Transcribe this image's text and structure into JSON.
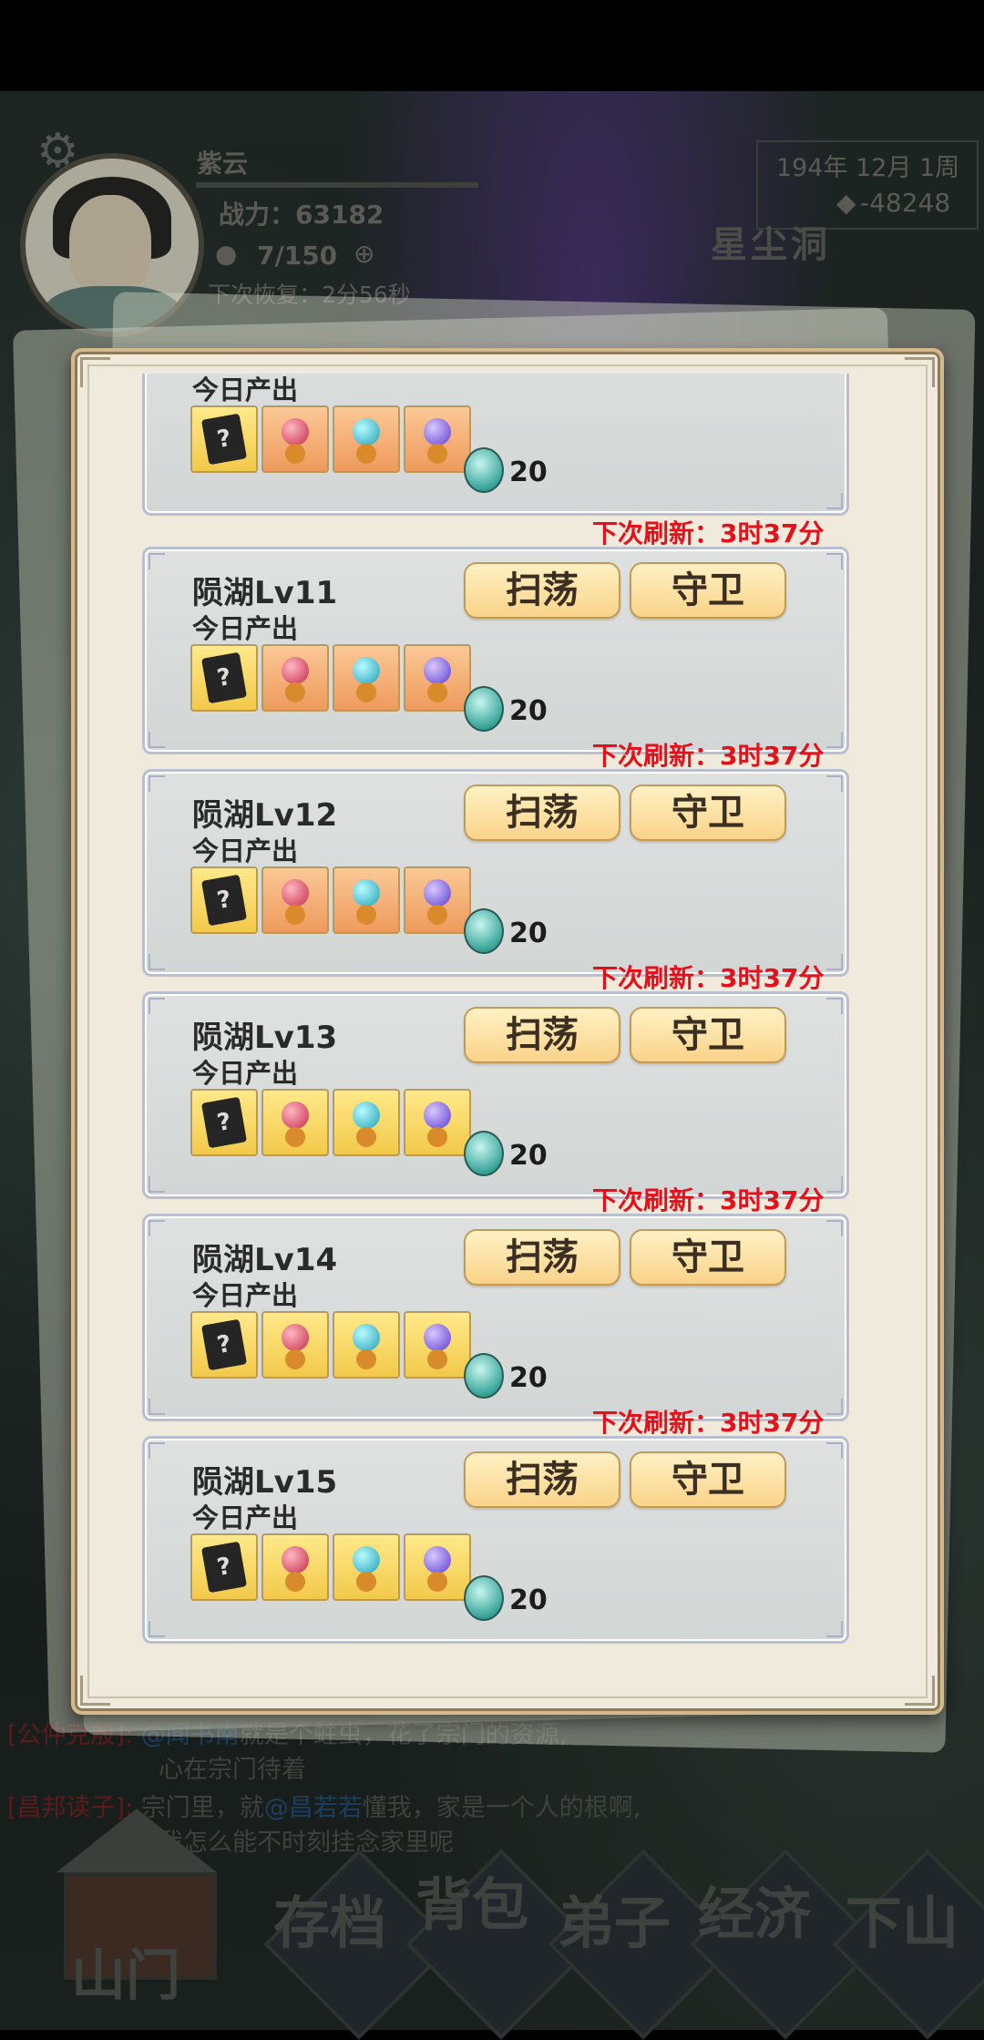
{
  "header": {
    "player_name": "紫云",
    "power": "战力：63182",
    "stamina": "7/150",
    "recover": "下次恢复：2分56秒",
    "date": "194年 12月  1周",
    "currency": "-48248",
    "location": "星尘洞"
  },
  "panel": {
    "partial_card": {
      "today_label": "今日产出",
      "count": "20",
      "refresh": "下次刷新：3时37分"
    },
    "sweep_label": "扫荡",
    "guard_label": "守卫",
    "cards": [
      {
        "level": "陨湖Lv11",
        "today_label": "今日产出",
        "count": "20",
        "refresh": "下次刷新：3时37分",
        "item_bg": "orange"
      },
      {
        "level": "陨湖Lv12",
        "today_label": "今日产出",
        "count": "20",
        "refresh": "下次刷新：3时37分",
        "item_bg": "orange"
      },
      {
        "level": "陨湖Lv13",
        "today_label": "今日产出",
        "count": "20",
        "refresh": "下次刷新：3时37分",
        "item_bg": "yellow"
      },
      {
        "level": "陨湖Lv14",
        "today_label": "今日产出",
        "count": "20",
        "refresh": "下次刷新：3时37分",
        "item_bg": "yellow"
      },
      {
        "level": "陨湖Lv15",
        "today_label": "今日产出",
        "count": "20",
        "refresh": "",
        "item_bg": "yellow"
      }
    ],
    "item_icons": [
      "book-icon",
      "red-gem-icon",
      "cyan-gem-icon",
      "purple-gem-icon"
    ]
  },
  "chat": [
    {
      "who": "[公仲克殷]:",
      "at": "@闻书南",
      "text": "就是个蛀虫，花了宗门的资源,",
      "line2": "心在宗门待着"
    },
    {
      "who": "[昌邦读子]:",
      "text1": "宗门里，就",
      "at": "@昌若若",
      "text2": "懂我，家是一个人的根啊,",
      "line2": "我怎么能不时刻挂念家里呢"
    }
  ],
  "nav": [
    "山门",
    "存档",
    "背包",
    "弟子",
    "经济",
    "下山"
  ],
  "colors": {
    "refresh_red": "#e5101a",
    "button_gold": "#fad38a",
    "panel_bg": "#efeadb"
  }
}
